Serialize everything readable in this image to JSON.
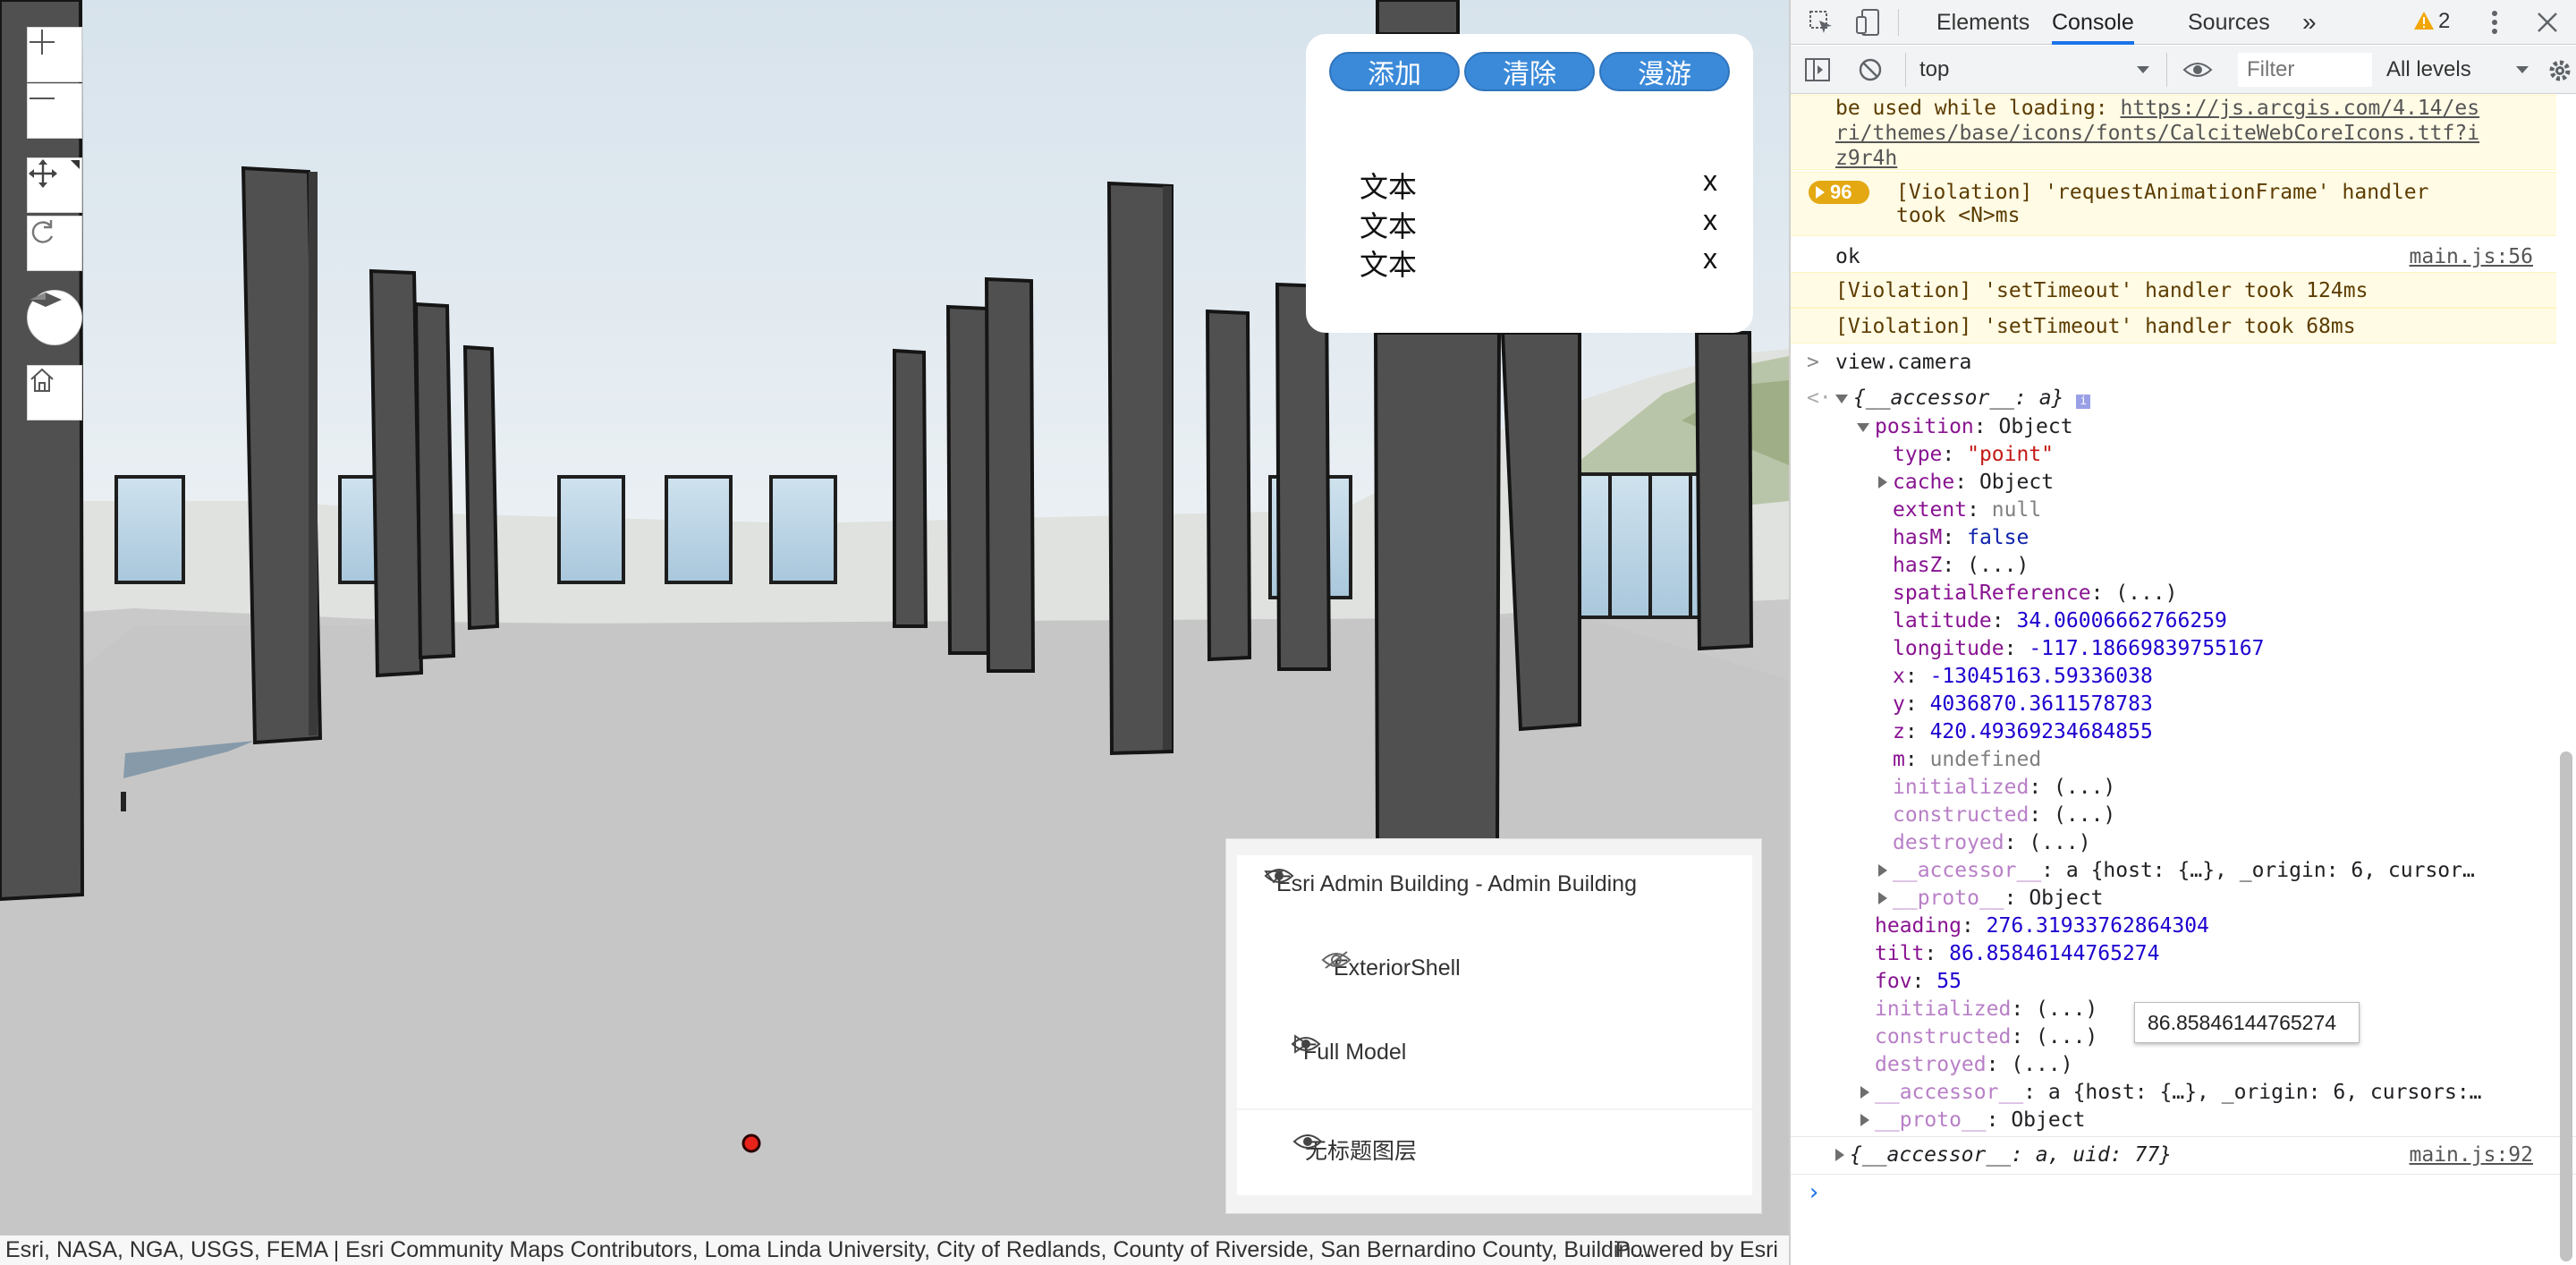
{
  "map_controls": {
    "zoom_in": "zoom-in-icon",
    "zoom_out": "zoom-out-icon",
    "pan": "pan-icon",
    "rotate": "rotate-icon",
    "compass": "compass-icon",
    "home": "home-icon"
  },
  "tool_panel": {
    "buttons": [
      "添加",
      "清除",
      "漫游"
    ],
    "items": [
      {
        "label": "文本",
        "close": "x"
      },
      {
        "label": "文本",
        "close": "x"
      },
      {
        "label": "文本",
        "close": "x"
      }
    ]
  },
  "layer_list": {
    "group_title": "Esri Admin Building - Admin Building",
    "children": [
      {
        "label": "ExteriorShell",
        "visible": false
      },
      {
        "label": "Full Model",
        "visible": true
      }
    ],
    "extra_layer": "无标题图层"
  },
  "attribution": {
    "text": "Esri, NASA, NGA, USGS, FEMA | Esri Community Maps Contributors, Loma Linda University, City of Redlands, County of Riverside, San Bernardino County, Buildin…",
    "powered": "Powered by Esri"
  },
  "devtools": {
    "tabs": [
      "Elements",
      "Console",
      "Sources",
      "»"
    ],
    "active_tab": "Console",
    "warning_count": "2",
    "context": "top",
    "filter_placeholder": "Filter",
    "levels": "All levels"
  },
  "console": {
    "l1": "be used while loading: ",
    "l1_url_a": "https://js.arcgis.com/4.14/es",
    "l1_url_b": "ri/themes/base/icons/fonts/CalciteWebCoreIcons.ttf?i",
    "l1_url_c": "z9r4h",
    "repeat_count": "96",
    "violation_raf_a": "[Violation] 'requestAnimationFrame' handler",
    "violation_raf_b": "took <N>ms",
    "ok": "ok",
    "ok_src": "main.js:56",
    "violation_t1": "[Violation] 'setTimeout' handler took 124ms",
    "violation_t2": "[Violation] 'setTimeout' handler took 68ms",
    "input": "view.camera",
    "obj_head": "{__accessor__: a}",
    "position": "position",
    "position_val": "Object",
    "type_k": "type",
    "type_v": "\"point\"",
    "cache_k": "cache",
    "cache_v": "Object",
    "extent_k": "extent",
    "extent_v": "null",
    "hasM_k": "hasM",
    "hasM_v": "false",
    "hasZ_k": "hasZ",
    "hasZ_v": "(...)",
    "sr_k": "spatialReference",
    "sr_v": "(...)",
    "lat_k": "latitude",
    "lat_v": "34.06006662766259",
    "lon_k": "longitude",
    "lon_v": "-117.18669839755167",
    "x_k": "x",
    "x_v": "-13045163.59336038",
    "y_k": "y",
    "y_v": "4036870.3611578783",
    "z_k": "z",
    "z_v": "420.49369234684855",
    "m_k": "m",
    "m_v": "undefined",
    "init_k": "initialized",
    "init_v": "(...)",
    "cons_k": "constructed",
    "cons_v": "(...)",
    "dest_k": "destroyed",
    "dest_v": "(...)",
    "acc_k": "__accessor__",
    "acc_v1": "a {host: {…}, _origin: 6, cursor…",
    "proto_k": "__proto__",
    "proto_v": "Object",
    "heading_k": "heading",
    "heading_v": "276.31933762864304",
    "tilt_k": "tilt",
    "tilt_v": "86.85846144765274",
    "fov_k": "fov",
    "fov_v": "55",
    "acc_v2": "a {host: {…}, _origin: 6, cursors:…",
    "last_obj": "{__accessor__: a, uid: 77}",
    "last_src": "main.js:92",
    "tooltip": "86.85846144765274"
  }
}
